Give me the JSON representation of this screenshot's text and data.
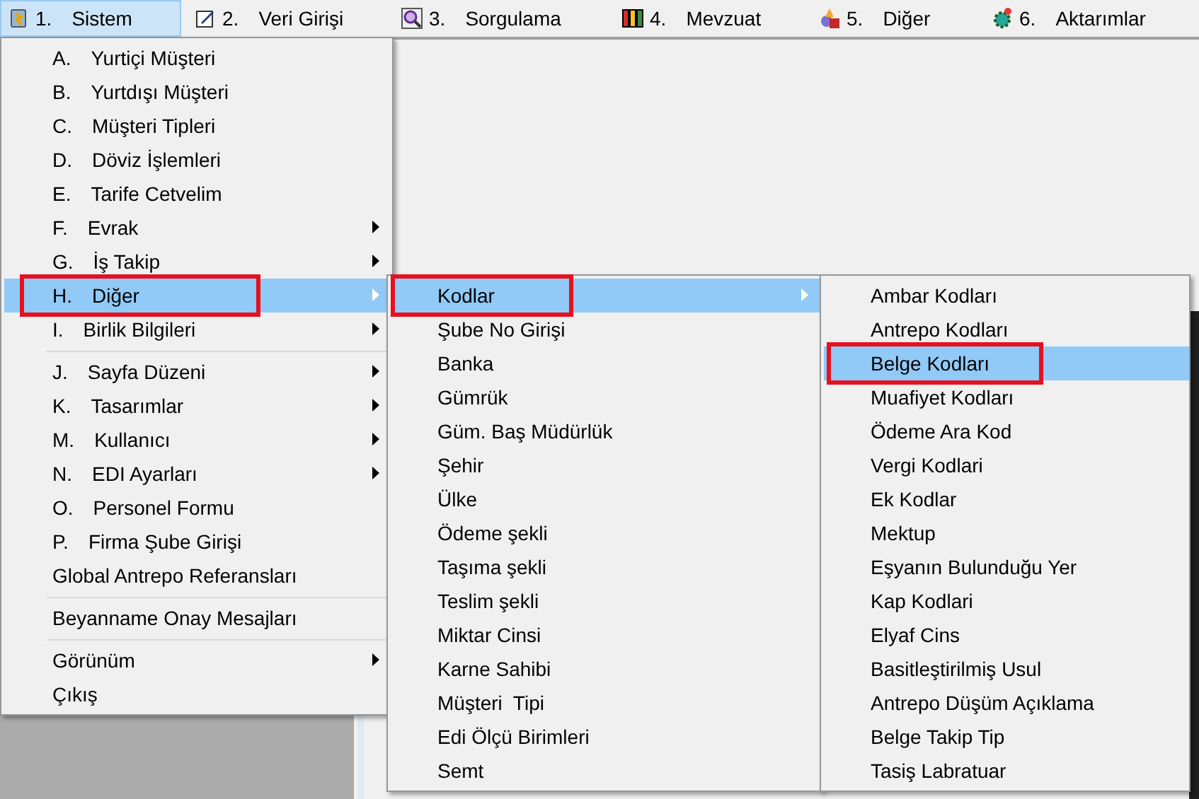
{
  "menu_bar": [
    {
      "number": "1.",
      "label": "Sistem",
      "selected": true
    },
    {
      "number": "2.",
      "label": "Veri Girişi",
      "selected": false
    },
    {
      "number": "3.",
      "label": "Sorgulama",
      "selected": false
    },
    {
      "number": "4.",
      "label": "Mevzuat",
      "selected": false
    },
    {
      "number": "5.",
      "label": "Diğer",
      "selected": false
    },
    {
      "number": "6.",
      "label": "Aktarımlar",
      "selected": false
    }
  ],
  "main_menu": {
    "items": [
      {
        "kind": "item",
        "key": "A.",
        "label": "Yurtiçi Müşteri",
        "has_submenu": false,
        "selected": false,
        "highlighted": false
      },
      {
        "kind": "item",
        "key": "B.",
        "label": "Yurtdışı Müşteri",
        "has_submenu": false,
        "selected": false,
        "highlighted": false
      },
      {
        "kind": "item",
        "key": "C.",
        "label": "Müşteri Tipleri",
        "has_submenu": false,
        "selected": false,
        "highlighted": false
      },
      {
        "kind": "item",
        "key": "D.",
        "label": "Döviz İşlemleri",
        "has_submenu": false,
        "selected": false,
        "highlighted": false
      },
      {
        "kind": "item",
        "key": "E.",
        "label": "Tarife Cetvelim",
        "has_submenu": false,
        "selected": false,
        "highlighted": false
      },
      {
        "kind": "item",
        "key": "F.",
        "label": "Evrak",
        "has_submenu": true,
        "selected": false,
        "highlighted": false
      },
      {
        "kind": "item",
        "key": "G.",
        "label": "İş Takip",
        "has_submenu": true,
        "selected": false,
        "highlighted": false
      },
      {
        "kind": "item",
        "key": "H.",
        "label": "Diğer",
        "has_submenu": true,
        "selected": true,
        "highlighted": true
      },
      {
        "kind": "item",
        "key": "I.",
        "label": "Birlik Bilgileri",
        "has_submenu": true,
        "selected": false,
        "highlighted": false
      },
      {
        "kind": "separator"
      },
      {
        "kind": "item",
        "key": "J.",
        "label": "Sayfa Düzeni",
        "has_submenu": true,
        "selected": false,
        "highlighted": false
      },
      {
        "kind": "item",
        "key": "K.",
        "label": "Tasarımlar",
        "has_submenu": true,
        "selected": false,
        "highlighted": false
      },
      {
        "kind": "item",
        "key": "M.",
        "label": "Kullanıcı",
        "has_submenu": true,
        "selected": false,
        "highlighted": false
      },
      {
        "kind": "item",
        "key": "N.",
        "label": "EDI Ayarları",
        "has_submenu": true,
        "selected": false,
        "highlighted": false
      },
      {
        "kind": "item",
        "key": "O.",
        "label": "Personel Formu",
        "has_submenu": false,
        "selected": false,
        "highlighted": false
      },
      {
        "kind": "item",
        "key": "P.",
        "label": "Firma Şube Girişi",
        "has_submenu": false,
        "selected": false,
        "highlighted": false
      },
      {
        "kind": "item",
        "label": "Global Antrepo Referansları",
        "has_submenu": false,
        "selected": false,
        "highlighted": false
      },
      {
        "kind": "separator"
      },
      {
        "kind": "item",
        "label": "Beyanname Onay Mesajları",
        "has_submenu": false,
        "selected": false,
        "highlighted": false
      },
      {
        "kind": "separator"
      },
      {
        "kind": "item",
        "label": "Görünüm",
        "has_submenu": true,
        "selected": false,
        "highlighted": false
      },
      {
        "kind": "item",
        "label": "Çıkış",
        "has_submenu": false,
        "selected": false,
        "highlighted": false
      }
    ]
  },
  "submenu": {
    "items": [
      {
        "kind": "item",
        "label": "Kodlar",
        "has_submenu": true,
        "selected": true,
        "highlighted": true
      },
      {
        "kind": "item",
        "label": "Şube No Girişi",
        "has_submenu": false,
        "selected": false,
        "highlighted": false
      },
      {
        "kind": "item",
        "label": "Banka",
        "has_submenu": false,
        "selected": false,
        "highlighted": false
      },
      {
        "kind": "item",
        "label": "Gümrük",
        "has_submenu": false,
        "selected": false,
        "highlighted": false
      },
      {
        "kind": "item",
        "label": "Güm. Baş Müdürlük",
        "has_submenu": false,
        "selected": false,
        "highlighted": false
      },
      {
        "kind": "item",
        "label": "Şehir",
        "has_submenu": false,
        "selected": false,
        "highlighted": false
      },
      {
        "kind": "item",
        "label": "Ülke",
        "has_submenu": false,
        "selected": false,
        "highlighted": false
      },
      {
        "kind": "item",
        "label": "Ödeme şekli",
        "has_submenu": false,
        "selected": false,
        "highlighted": false
      },
      {
        "kind": "item",
        "label": "Taşıma şekli",
        "has_submenu": false,
        "selected": false,
        "highlighted": false
      },
      {
        "kind": "item",
        "label": "Teslim şekli",
        "has_submenu": false,
        "selected": false,
        "highlighted": false
      },
      {
        "kind": "item",
        "label": "Miktar Cinsi",
        "has_submenu": false,
        "selected": false,
        "highlighted": false
      },
      {
        "kind": "item",
        "label": "Karne Sahibi",
        "has_submenu": false,
        "selected": false,
        "highlighted": false
      },
      {
        "kind": "item",
        "label": "Müşteri  Tipi",
        "has_submenu": false,
        "selected": false,
        "highlighted": false
      },
      {
        "kind": "item",
        "label": "Edi Ölçü Birimleri",
        "has_submenu": false,
        "selected": false,
        "highlighted": false
      },
      {
        "kind": "item",
        "label": "Semt",
        "has_submenu": false,
        "selected": false,
        "highlighted": false
      }
    ]
  },
  "codes_menu": {
    "items": [
      {
        "kind": "item",
        "label": "Ambar Kodları",
        "has_submenu": false,
        "selected": false,
        "highlighted": false
      },
      {
        "kind": "item",
        "label": "Antrepo Kodları",
        "has_submenu": false,
        "selected": false,
        "highlighted": false
      },
      {
        "kind": "item",
        "label": "Belge Kodları",
        "has_submenu": false,
        "selected": true,
        "highlighted": true
      },
      {
        "kind": "item",
        "label": "Muafiyet Kodları",
        "has_submenu": false,
        "selected": false,
        "highlighted": false
      },
      {
        "kind": "item",
        "label": "Ödeme Ara Kod",
        "has_submenu": false,
        "selected": false,
        "highlighted": false
      },
      {
        "kind": "item",
        "label": "Vergi Kodlari",
        "has_submenu": false,
        "selected": false,
        "highlighted": false
      },
      {
        "kind": "item",
        "label": "Ek Kodlar",
        "has_submenu": false,
        "selected": false,
        "highlighted": false
      },
      {
        "kind": "item",
        "label": "Mektup",
        "has_submenu": false,
        "selected": false,
        "highlighted": false
      },
      {
        "kind": "item",
        "label": "Eşyanın Bulunduğu Yer",
        "has_submenu": false,
        "selected": false,
        "highlighted": false
      },
      {
        "kind": "item",
        "label": "Kap Kodlari",
        "has_submenu": false,
        "selected": false,
        "highlighted": false
      },
      {
        "kind": "item",
        "label": "Elyaf Cins",
        "has_submenu": false,
        "selected": false,
        "highlighted": false
      },
      {
        "kind": "item",
        "label": "Basitleştirilmiş Usul",
        "has_submenu": false,
        "selected": false,
        "highlighted": false
      },
      {
        "kind": "item",
        "label": "Antrepo Düşüm Açıklama",
        "has_submenu": false,
        "selected": false,
        "highlighted": false
      },
      {
        "kind": "item",
        "label": "Belge Takip Tip",
        "has_submenu": false,
        "selected": false,
        "highlighted": false
      },
      {
        "kind": "item",
        "label": "Tasiş Labratuar",
        "has_submenu": false,
        "selected": false,
        "highlighted": false
      }
    ]
  }
}
